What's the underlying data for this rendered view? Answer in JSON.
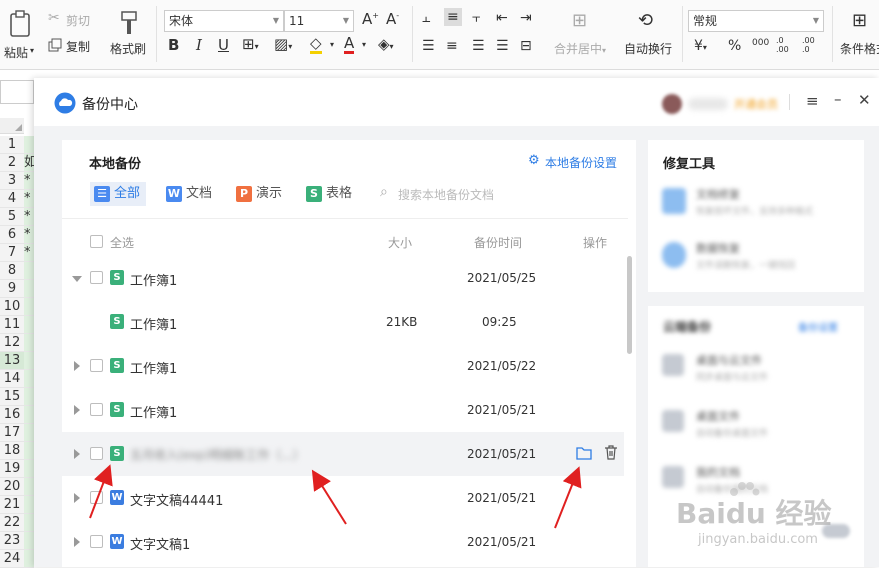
{
  "ribbon": {
    "paste": "粘贴",
    "cut": "剪切",
    "copy": "复制",
    "format_painter": "格式刷",
    "font_name": "宋体",
    "font_size": "11",
    "bold": "B",
    "italic": "I",
    "underline": "U",
    "merge_center": "合并居中",
    "wrap_text": "自动换行",
    "number_format": "常规",
    "currency": "¥",
    "percent": "%",
    "thousands": "000",
    "dec_inc": ".0 .00",
    "dec_dec": ".00 .0",
    "cond_format": "条件格式"
  },
  "sheet": {
    "row_numbers": [
      "1",
      "2",
      "3",
      "4",
      "5",
      "6",
      "7",
      "8",
      "9",
      "10",
      "11",
      "12",
      "13",
      "14",
      "15",
      "16",
      "17",
      "18",
      "19",
      "20",
      "21",
      "22",
      "23",
      "24"
    ],
    "col_vals": [
      "",
      "如",
      "*",
      "*",
      "*",
      "*",
      "*"
    ]
  },
  "dialog": {
    "title": "备份中心",
    "username": "开通会员",
    "local_backup": {
      "title": "本地备份",
      "settings": "本地备份设置",
      "tabs": [
        {
          "label": "全部"
        },
        {
          "label": "文档"
        },
        {
          "label": "演示"
        },
        {
          "label": "表格"
        }
      ],
      "search_placeholder": "搜索本地备份文档",
      "header": {
        "select_all": "全选",
        "size": "大小",
        "time": "备份时间",
        "action": "操作"
      },
      "rows": [
        {
          "name": "工作簿1",
          "size": "",
          "time": "2021/05/25"
        },
        {
          "name": "工作簿1",
          "size": "21KB",
          "time": "09:25"
        },
        {
          "name": "工作簿1",
          "size": "",
          "time": "2021/05/22"
        },
        {
          "name": "工作簿1",
          "size": "",
          "time": "2021/05/21"
        },
        {
          "name": "五月收入(exp)明细账工作（...）",
          "size": "",
          "time": "2021/05/21"
        },
        {
          "name": "文字文稿44441",
          "size": "",
          "time": "2021/05/21"
        },
        {
          "name": "文字文稿1",
          "size": "",
          "time": "2021/05/21"
        }
      ]
    },
    "repair": {
      "title": "修复工具",
      "items": [
        {
          "name": "文档修复",
          "desc": "恢复损坏文件，支持多种格式"
        },
        {
          "name": "数据恢复",
          "desc": "文件误删恢复，一键找回"
        }
      ]
    },
    "cloud": {
      "title": "云端备份",
      "link": "备份设置",
      "items": [
        {
          "name": "桌面与云文件",
          "desc": "同步桌面与云文件"
        },
        {
          "name": "桌面文件",
          "desc": "自动备份桌面文件"
        },
        {
          "name": "我的文档",
          "desc": "自动备份我的文档"
        }
      ]
    }
  },
  "watermark": {
    "brand": "Baidu 经验",
    "url": "jingyan.baidu.com"
  }
}
